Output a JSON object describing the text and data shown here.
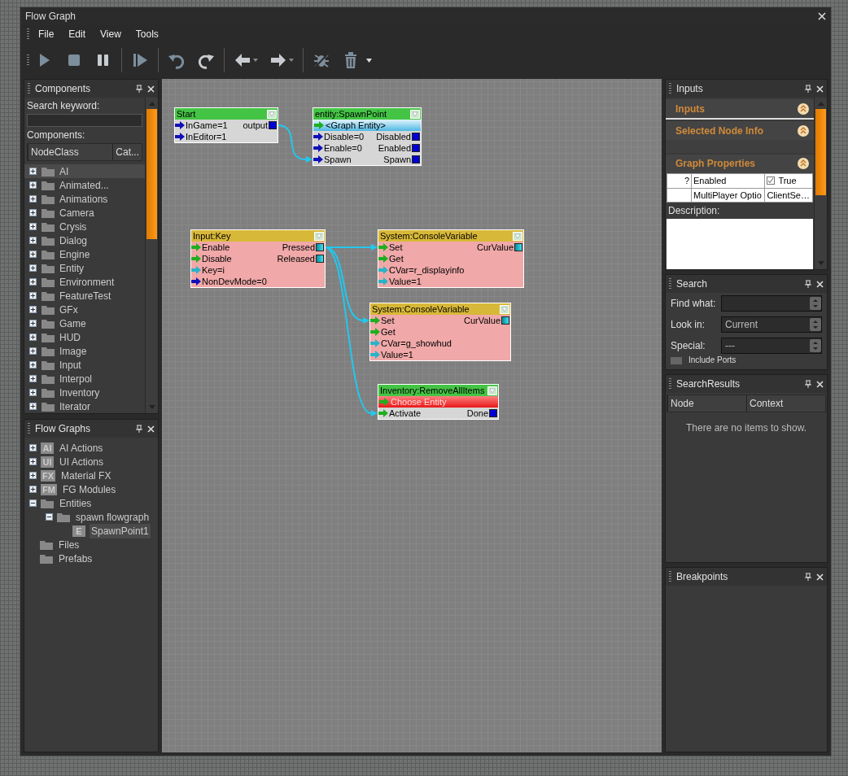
{
  "window": {
    "title": "Flow Graph"
  },
  "menu": [
    "File",
    "Edit",
    "View",
    "Tools"
  ],
  "toolbar": [
    {
      "kind": "play"
    },
    {
      "kind": "stop"
    },
    {
      "kind": "pause"
    },
    {
      "kind": "separator"
    },
    {
      "kind": "step"
    },
    {
      "kind": "separator"
    },
    {
      "kind": "undo"
    },
    {
      "kind": "redo"
    },
    {
      "kind": "separator"
    },
    {
      "kind": "back",
      "dropdown": true
    },
    {
      "kind": "forward",
      "dropdown": true
    },
    {
      "kind": "separator"
    },
    {
      "kind": "debug"
    },
    {
      "kind": "delete"
    },
    {
      "kind": "overflow"
    }
  ],
  "components_panel": {
    "title": "Components",
    "search_label": "Search keyword:",
    "list_label": "Components:",
    "columns": [
      "NodeClass",
      "Cat..."
    ],
    "items": [
      {
        "label": "AI",
        "selected": true
      },
      {
        "label": "Animated...",
        "selected": false
      },
      {
        "label": "Animations",
        "selected": false
      },
      {
        "label": "Camera",
        "selected": false
      },
      {
        "label": "Crysis",
        "selected": false
      },
      {
        "label": "Dialog",
        "selected": false
      },
      {
        "label": "Engine",
        "selected": false
      },
      {
        "label": "Entity",
        "selected": false
      },
      {
        "label": "Environment",
        "selected": false
      },
      {
        "label": "FeatureTest",
        "selected": false
      },
      {
        "label": "GFx",
        "selected": false
      },
      {
        "label": "Game",
        "selected": false
      },
      {
        "label": "HUD",
        "selected": false
      },
      {
        "label": "Image",
        "selected": false
      },
      {
        "label": "Input",
        "selected": false
      },
      {
        "label": "Interpol",
        "selected": false
      },
      {
        "label": "Inventory",
        "selected": false
      },
      {
        "label": "Iterator",
        "selected": false
      }
    ]
  },
  "flow_graphs_panel": {
    "title": "Flow Graphs",
    "tree": [
      {
        "label": "AI Actions",
        "badge": "AI",
        "expanded": false,
        "selected": false
      },
      {
        "label": "UI Actions",
        "badge": "UI",
        "expanded": false,
        "selected": false
      },
      {
        "label": "Material FX",
        "badge": "FX",
        "expanded": false,
        "selected": false
      },
      {
        "label": "FG Modules",
        "badge": "FM",
        "expanded": false,
        "selected": false
      },
      {
        "label": "Entities",
        "expanded": true,
        "selected": false,
        "children": [
          {
            "label": "spawn flowgraph",
            "expanded": true,
            "selected": false,
            "children": [
              {
                "label": "SpawnPoint1",
                "badge": "E",
                "selected": true
              }
            ]
          }
        ]
      },
      {
        "label": "Files",
        "selected": false
      },
      {
        "label": "Prefabs",
        "selected": false
      }
    ]
  },
  "graph": {
    "nodes": [
      {
        "title": "Start",
        "color": "#44c444",
        "kind": "entity",
        "rows": [
          {
            "kind": "port",
            "input": {
              "label": "InGame=1",
              "kind": "bool"
            },
            "output": {
              "label": "output",
              "kind": "bool"
            }
          },
          {
            "kind": "port",
            "input": {
              "label": "InEditor=1",
              "kind": "bool"
            }
          }
        ]
      },
      {
        "title": "entity:SpawnPoint",
        "color": "#44c444",
        "kind": "entity",
        "rows": [
          {
            "kind": "entity",
            "label": "<Graph Entity>",
            "assigned": true
          },
          {
            "kind": "port",
            "input": {
              "label": "Disable=0",
              "kind": "bool"
            },
            "output": {
              "label": "Disabled",
              "kind": "bool"
            }
          },
          {
            "kind": "port",
            "input": {
              "label": "Enable=0",
              "kind": "bool"
            },
            "output": {
              "label": "Enabled",
              "kind": "bool"
            }
          },
          {
            "kind": "port",
            "input": {
              "label": "Spawn",
              "kind": "bool"
            },
            "output": {
              "label": "Spawn",
              "kind": "bool"
            }
          }
        ]
      },
      {
        "title": "Input:Key",
        "color": "#d8b838",
        "kind": "logic",
        "rows": [
          {
            "kind": "port",
            "input": {
              "label": "Enable",
              "kind": "trigger"
            },
            "output": {
              "label": "Pressed",
              "kind": "value"
            }
          },
          {
            "kind": "port",
            "input": {
              "label": "Disable",
              "kind": "trigger"
            },
            "output": {
              "label": "Released",
              "kind": "value"
            }
          },
          {
            "kind": "port",
            "input": {
              "label": "Key=i",
              "kind": "value"
            }
          },
          {
            "kind": "port",
            "input": {
              "label": "NonDevMode=0",
              "kind": "bool"
            }
          }
        ]
      },
      {
        "title": "System:ConsoleVariable",
        "color": "#d8b838",
        "kind": "logic",
        "rows": [
          {
            "kind": "port",
            "input": {
              "label": "Set",
              "kind": "trigger"
            },
            "output": {
              "label": "CurValue",
              "kind": "value"
            }
          },
          {
            "kind": "port",
            "input": {
              "label": "Get",
              "kind": "trigger"
            }
          },
          {
            "kind": "port",
            "input": {
              "label": "CVar=r_displayinfo",
              "kind": "value"
            }
          },
          {
            "kind": "port",
            "input": {
              "label": "Value=1",
              "kind": "value"
            }
          }
        ]
      },
      {
        "title": "System:ConsoleVariable",
        "color": "#d8b838",
        "kind": "logic",
        "rows": [
          {
            "kind": "port",
            "input": {
              "label": "Set",
              "kind": "trigger"
            },
            "output": {
              "label": "CurValue",
              "kind": "value"
            }
          },
          {
            "kind": "port",
            "input": {
              "label": "Get",
              "kind": "trigger"
            }
          },
          {
            "kind": "port",
            "input": {
              "label": "CVar=g_showhud",
              "kind": "value"
            }
          },
          {
            "kind": "port",
            "input": {
              "label": "Value=1",
              "kind": "value"
            }
          }
        ]
      },
      {
        "title": "Inventory:RemoveAllItems",
        "color": "#44c444",
        "kind": "entity",
        "rows": [
          {
            "kind": "entity",
            "label": "Choose Entity",
            "assigned": false
          },
          {
            "kind": "port",
            "input": {
              "label": "Activate",
              "kind": "trigger"
            },
            "output": {
              "label": "Done",
              "kind": "bool"
            }
          }
        ]
      }
    ]
  },
  "inputs_panel": {
    "title": "Inputs",
    "sections": [
      {
        "title": "Inputs",
        "expanded": true
      },
      {
        "title": "Selected Node Info",
        "expanded": true
      },
      {
        "title": "Graph Properties",
        "expanded": true,
        "properties": [
          {
            "help": "?",
            "name": "Enabled",
            "kind": "checkbox",
            "checked": true,
            "value": "True"
          },
          {
            "name": "MultiPlayer Optio",
            "kind": "text",
            "value": "ClientSe…"
          }
        ]
      }
    ],
    "description_label": "Description:"
  },
  "search_panel": {
    "title": "Search",
    "fields": [
      {
        "label": "Find what:"
      },
      {
        "label": "Look in:",
        "value": "Current"
      },
      {
        "label": "Special:",
        "value": "---"
      }
    ],
    "include_ports": {
      "label": "Include Ports",
      "checked": false
    }
  },
  "search_results_panel": {
    "title": "SearchResults",
    "columns": [
      "Node",
      "Context"
    ],
    "empty_message": "There are no items to show."
  },
  "breakpoints_panel": {
    "title": "Breakpoints"
  }
}
